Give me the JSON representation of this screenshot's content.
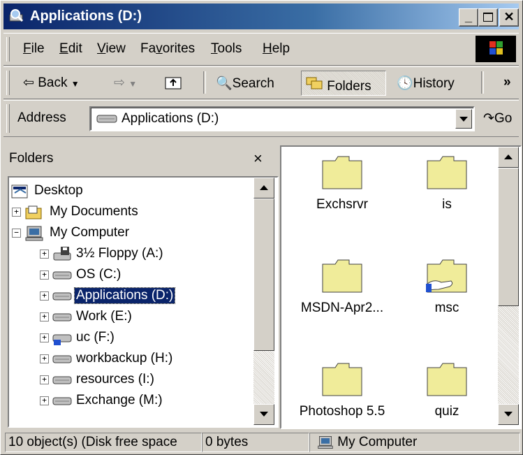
{
  "window": {
    "title": "Applications (D:)"
  },
  "menu": {
    "items": [
      "File",
      "Edit",
      "View",
      "Favorites",
      "Tools",
      "Help"
    ],
    "underline": [
      "F",
      "E",
      "V",
      "v",
      "T",
      "H"
    ]
  },
  "toolbar": {
    "back_label": "Back",
    "search_label": "Search",
    "folders_label": "Folders",
    "history_label": "History",
    "overflow_label": "»"
  },
  "address": {
    "label": "Address",
    "value": "Applications (D:)",
    "go_label": "Go"
  },
  "folders_pane": {
    "header": "Folders",
    "close": "×",
    "tree": [
      {
        "label": "Desktop",
        "icon": "desktop-icon"
      },
      {
        "label": "My Documents",
        "icon": "my-documents-icon"
      },
      {
        "label": "My Computer",
        "icon": "my-computer-icon"
      },
      {
        "label": "3½ Floppy (A:)",
        "icon": "floppy-drive-icon"
      },
      {
        "label": "OS (C:)",
        "icon": "hard-drive-icon"
      },
      {
        "label": "Applications (D:)",
        "icon": "hard-drive-icon",
        "selected": true
      },
      {
        "label": "Work (E:)",
        "icon": "hard-drive-icon"
      },
      {
        "label": "uc (F:)",
        "icon": "shared-drive-icon"
      },
      {
        "label": "workbackup (H:)",
        "icon": "hard-drive-icon"
      },
      {
        "label": "resources (I:)",
        "icon": "hard-drive-icon"
      },
      {
        "label": "Exchange (M:)",
        "icon": "hard-drive-icon"
      }
    ]
  },
  "content": {
    "items": [
      {
        "label": "Exchsrvr",
        "shared": false
      },
      {
        "label": "is",
        "shared": false
      },
      {
        "label": "MSDN-Apr2...",
        "shared": false
      },
      {
        "label": "msc",
        "shared": true
      },
      {
        "label": "Photoshop 5.5",
        "shared": false
      },
      {
        "label": "quiz",
        "shared": false
      }
    ]
  },
  "status": {
    "objects": "10 object(s) (Disk free space",
    "size": "0 bytes",
    "zone": "My Computer"
  },
  "colors": {
    "title_start": "#0a246a",
    "title_end": "#a6caf0",
    "folder": "#f0ec9a",
    "selection": "#0a246a"
  }
}
